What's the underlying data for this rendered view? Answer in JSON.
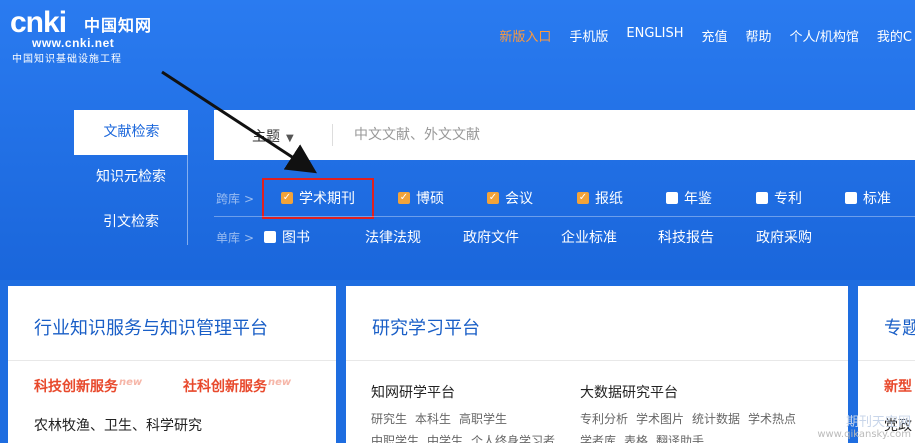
{
  "logo": {
    "mark": "cnki",
    "mark_cn": "中国知网",
    "url": "www.cnki.net",
    "tagline": "中国知识基础设施工程"
  },
  "topnav": [
    "新版入口",
    "手机版",
    "ENGLISH",
    "充值",
    "帮助",
    "个人/机构馆",
    "我的C"
  ],
  "search_tabs": [
    "文献检索",
    "知识元检索",
    "引文检索"
  ],
  "search": {
    "field": "主题",
    "placeholder": "中文文献、外文文献"
  },
  "kuaku": {
    "label": "跨库",
    "items": [
      {
        "label": "学术期刊",
        "checked": true
      },
      {
        "label": "博硕",
        "checked": true
      },
      {
        "label": "会议",
        "checked": true
      },
      {
        "label": "报纸",
        "checked": true
      },
      {
        "label": "年鉴",
        "checked": false
      },
      {
        "label": "专利",
        "checked": false
      },
      {
        "label": "标准",
        "checked": false
      }
    ]
  },
  "danku": {
    "label": "单库",
    "items": [
      "图书",
      "法律法规",
      "政府文件",
      "企业标准",
      "科技报告",
      "政府采购"
    ]
  },
  "cards": {
    "one": {
      "title": "行业知识服务与知识管理平台",
      "links": [
        "科技创新服务",
        "社科创新服务"
      ],
      "new_badge": "new",
      "body": "农林牧渔、卫生、科学研究"
    },
    "two": {
      "title": "研究学习平台",
      "left_head": "知网研学平台",
      "left_items": [
        "研究生",
        "本科生",
        "高职学生"
      ],
      "left_items2": [
        "中职学生",
        "中学生",
        "个人终身学习者"
      ],
      "right_head": "大数据研究平台",
      "right_items": [
        "专利分析",
        "学术图片",
        "统计数据",
        "学术热点"
      ],
      "right_items2": [
        "学者库",
        "表格",
        "翻译助手"
      ]
    },
    "three": {
      "title": "专题",
      "red": "新型",
      "body": "党政"
    }
  },
  "watermark": {
    "big": "期刊天空网",
    "small": "www.qikansky.com"
  },
  "colors": {
    "hero": "#1e6de0",
    "accent": "#ff9a3c",
    "check": "#f2a33a",
    "highlight": "#e02020",
    "card_title": "#1a5fc7",
    "red_link": "#e8492c"
  }
}
